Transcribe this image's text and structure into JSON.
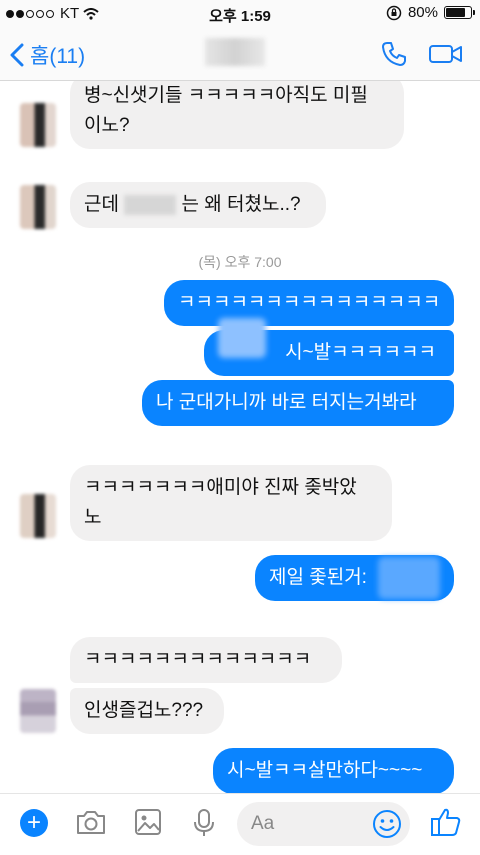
{
  "status": {
    "carrier": "KT",
    "time": "오후 1:59",
    "battery": "80%",
    "battery_level": 0.8
  },
  "nav": {
    "back_label": "홈(11)"
  },
  "messages": [
    {
      "side": "in",
      "line1": "병~신샛기들 ㅋㅋㅋㅋㅋ아직도 미필",
      "line2": "이노?"
    },
    {
      "side": "in",
      "part1": "근데",
      "part2": "는 왜 터쳤노..?"
    },
    {
      "side": "out",
      "text": "ㅋㅋㅋㅋㅋㅋㅋㅋㅋㅋㅋㅋㅋㅋㅋ"
    },
    {
      "side": "out",
      "text": "시~발ㅋㅋㅋㅋㅋㅋ"
    },
    {
      "side": "out",
      "text": "나 군대가니까 바로 터지는거봐라"
    },
    {
      "side": "in",
      "line1": "ㅋㅋㅋㅋㅋㅋㅋ애미야 진짜 좆박았",
      "line2": "노"
    },
    {
      "side": "out",
      "text": "제일 좇된거:"
    },
    {
      "side": "in",
      "text": "ㅋㅋㅋㅋㅋㅋㅋㅋㅋㅋㅋㅋㅋ"
    },
    {
      "side": "in",
      "text": "인생즐겁노???"
    },
    {
      "side": "out",
      "text": "시~발ㅋㅋ살만하다~~~~"
    }
  ],
  "timestamp": "(목) 오후 7:00",
  "composer": {
    "placeholder": "Aa",
    "plus": "+"
  },
  "icons": [
    "back-chevron-icon",
    "phone-icon",
    "video-icon",
    "plus-icon",
    "camera-icon",
    "image-icon",
    "microphone-icon",
    "emoji-icon",
    "thumbs-up-icon"
  ],
  "colors": {
    "accent": "#0a84ff",
    "incoming": "#f1f0f0",
    "nav_blue": "#1a7ef2"
  }
}
